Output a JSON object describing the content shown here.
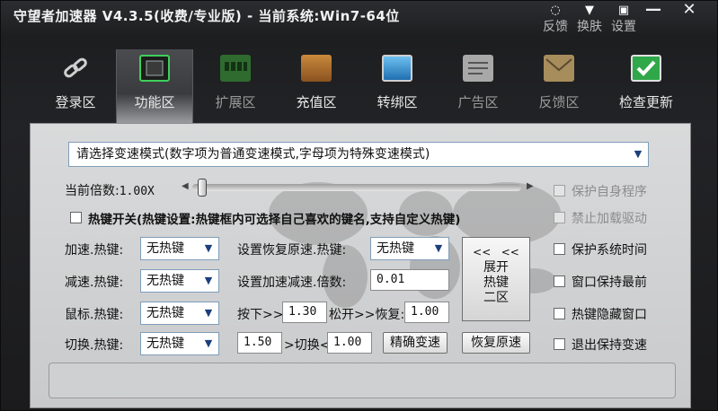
{
  "window": {
    "title": "守望者加速器 V4.3.5(收费/专业版) - 当前系统:Win7-64位",
    "buttons": {
      "feedback": "反馈",
      "skin": "换肤",
      "settings": "设置",
      "minimize": "—",
      "close": "✕"
    }
  },
  "nav": [
    {
      "label": "登录区",
      "icon": "link-icon"
    },
    {
      "label": "功能区",
      "icon": "chip-icon"
    },
    {
      "label": "扩展区",
      "icon": "memory-icon"
    },
    {
      "label": "充值区",
      "icon": "wallet-icon"
    },
    {
      "label": "转绑区",
      "icon": "monitor-icon"
    },
    {
      "label": "广告区",
      "icon": "newspaper-icon"
    },
    {
      "label": "反馈区",
      "icon": "envelope-icon"
    },
    {
      "label": "检查更新",
      "icon": "checkmark-icon"
    }
  ],
  "mode_select": {
    "value": "请选择变速模式(数字项为普通变速模式,字母项为特殊变速模式)"
  },
  "multiplier": {
    "label": "当前倍数:",
    "value": "1.00X",
    "fraction": 0.0
  },
  "hotkey_switch": {
    "label": "热键开关(热键设置:热键框内可选择自己喜欢的键名,支持自定义热键)"
  },
  "hotkeys": [
    {
      "label": "加速.热键:",
      "value": "无热键"
    },
    {
      "label": "减速.热键:",
      "value": "无热键"
    },
    {
      "label": "鼠标.热键:",
      "value": "无热键"
    },
    {
      "label": "切换.热键:",
      "value": "无热键"
    }
  ],
  "restore": {
    "label": "设置恢复原速.热键:",
    "value": "无热键"
  },
  "step": {
    "label": "设置加速减速.倍数:",
    "value": "0.01"
  },
  "press": {
    "label": "按下>>",
    "value": "1.30",
    "release_label": "松开>>恢复:",
    "release_value": "1.00"
  },
  "switch_row": {
    "from": "1.50",
    "mid_label": ">切换<",
    "to": "1.00",
    "precise_btn": "精确变速",
    "restore_btn": "恢复原速"
  },
  "expand_btn": {
    "arrows": "<<   <<",
    "line1": "展开",
    "line2": "热键",
    "line3": "二区"
  },
  "options": [
    {
      "label": "保护自身程序",
      "enabled": false
    },
    {
      "label": "禁止加载驱动",
      "enabled": false
    },
    {
      "label": "保护系统时间",
      "enabled": true
    },
    {
      "label": "窗口保持最前",
      "enabled": true
    },
    {
      "label": "热键隐藏窗口",
      "enabled": true
    },
    {
      "label": "退出保持变速",
      "enabled": true
    }
  ]
}
